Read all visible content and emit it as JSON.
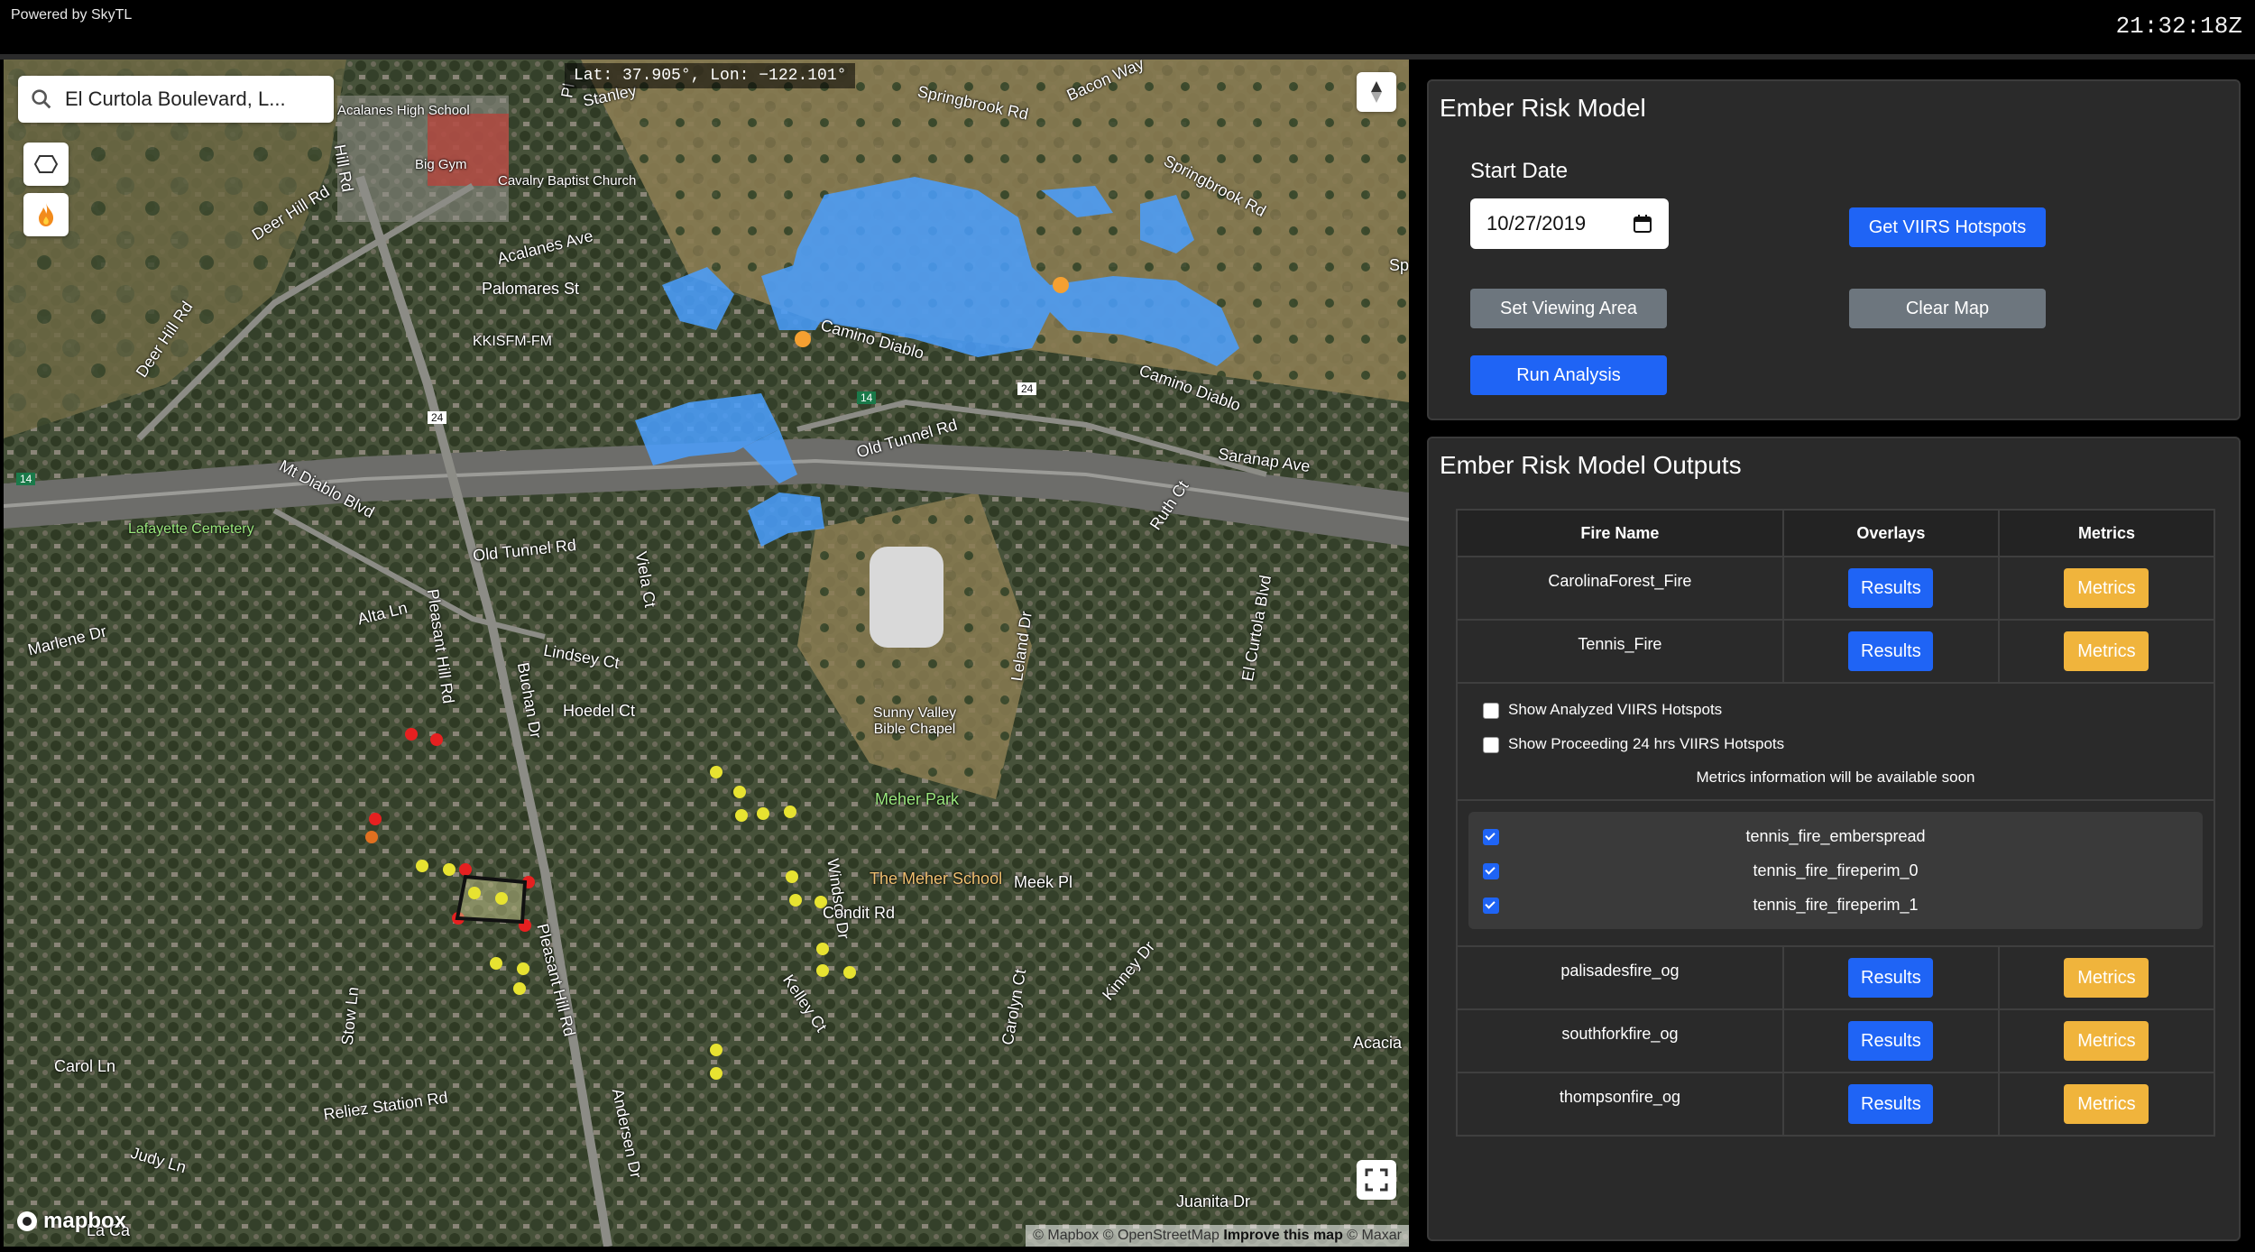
{
  "topbar": {
    "powered_by": "Powered by SkyTL",
    "clock": "21:32:18Z"
  },
  "map": {
    "search_value": "El Curtola Boulevard, L...",
    "coords": "Lat: 37.905°, Lon: −122.101°",
    "labels": {
      "acalanes_high": "Acalanes High School",
      "big_gym": "Big Gym",
      "cavalry": "Cavalry Baptist Church",
      "acalanes_ave": "Acalanes Ave",
      "palomares": "Palomares St",
      "kkisfm": "KKISFM-FM",
      "deer_hill_rd1": "Deer Hill Rd",
      "deer_hill_rd2": "Deer Hill Rd",
      "springbrook1": "Springbrook Rd",
      "springbrook2": "Springbrook Rd",
      "camino_diablo1": "Camino Diablo",
      "camino_diablo2": "Camino Diablo",
      "old_tunnel1": "Old Tunnel Rd",
      "old_tunnel2": "Old Tunnel Rd",
      "saranap": "Saranap Ave",
      "mt_diablo": "Mt Diablo Blvd",
      "lafayette_cem": "Lafayette Cemetery",
      "marlene": "Marlene Dr",
      "alta_ln": "Alta Ln",
      "lindsey_ct": "Lindsey Ct",
      "hoedel_ct": "Hoedel Ct",
      "pleasant_hill1": "Pleasant Hill Rd",
      "pleasant_hill2": "Pleasant Hill Rd",
      "buchan": "Buchan Dr",
      "viela": "Viela Ct",
      "sunny_valley": "Sunny Valley Bible Chapel",
      "meher_park": "Meher Park",
      "meher_school": "The Meher School",
      "windsor": "Windsor Dr",
      "condit": "Condit Rd",
      "meek": "Meek Pl",
      "kelley": "Kelley Ct",
      "carolyn": "Carolyn Ct",
      "kinney": "Kinney Dr",
      "leland": "Leland Dr",
      "el_curtola": "El Curtola Blvd",
      "ruth": "Ruth Ct",
      "carol_ln": "Carol Ln",
      "reliez": "Reliez Station Rd",
      "judy": "Judy Ln",
      "stow": "Stow Ln",
      "andersen": "Andersen Dr",
      "juanita": "Juanita Dr",
      "acacia": "Acacia",
      "hill_rd": "Hill Rd",
      "stanley": "Stanley",
      "bacon": "Bacon Way",
      "sp": "Sp",
      "pl": "Pl",
      "la_ca": "La Ca",
      "r14a": "14",
      "r14b": "14",
      "r24a": "24",
      "r24b": "24"
    },
    "mapbox_text": "mapbox",
    "attribution": {
      "a": "© Mapbox © OpenStreetMap ",
      "improve": "Improve this map",
      "b": " © Maxar"
    }
  },
  "model": {
    "title": "Ember Risk Model",
    "start_date_label": "Start Date",
    "start_date_value": "10/27/2019",
    "get_viirs": "Get VIIRS Hotspots",
    "set_view": "Set Viewing Area",
    "clear_map": "Clear Map",
    "run_analysis": "Run Analysis"
  },
  "outputs": {
    "title": "Ember Risk Model Outputs",
    "headers": [
      "Fire Name",
      "Overlays",
      "Metrics"
    ],
    "results_label": "Results",
    "metrics_label": "Metrics",
    "fires": [
      "CarolinaForest_Fire",
      "Tennis_Fire",
      "palisadesfire_og",
      "southforkfire_og",
      "thompsonfire_og"
    ],
    "show_analyzed": "Show Analyzed VIIRS Hotspots",
    "show_proceeding": "Show Proceeding 24 hrs VIIRS Hotspots",
    "metrics_note": "Metrics information will be available soon",
    "layers": [
      "tennis_fire_emberspread",
      "tennis_fire_fireperim_0",
      "tennis_fire_fireperim_1"
    ]
  },
  "colors": {
    "primary": "#1f64f5",
    "gray": "#6d767e",
    "warn": "#f0b43c",
    "ember_blue": "#4a9fff"
  }
}
